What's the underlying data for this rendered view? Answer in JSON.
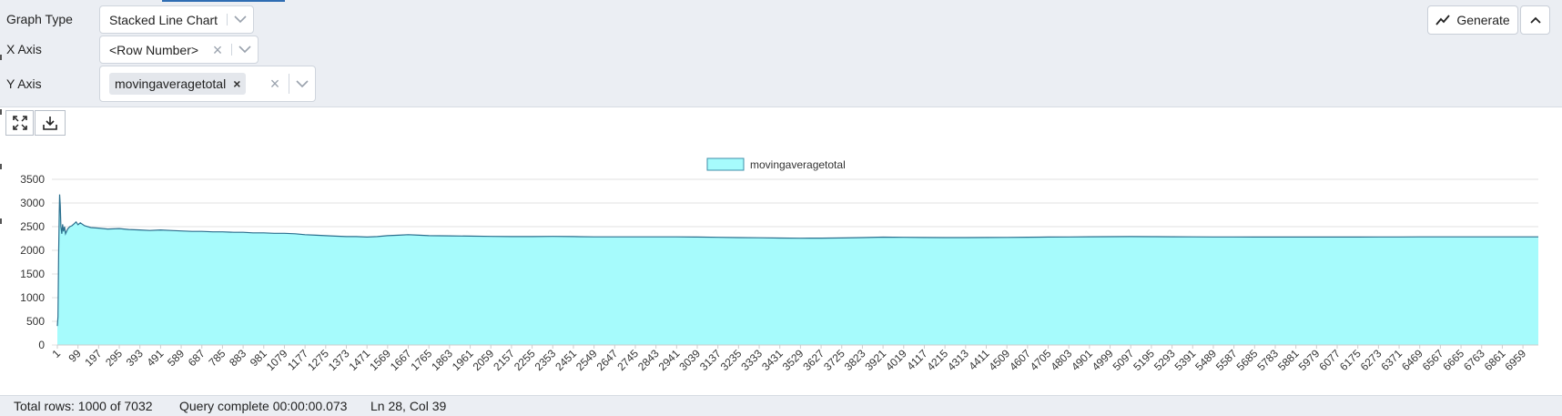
{
  "controls": {
    "graph_type_label": "Graph Type",
    "graph_type_value": "Stacked Line Chart",
    "x_axis_label": "X Axis",
    "x_axis_value": "<Row Number>",
    "y_axis_label": "Y Axis",
    "y_axis_tag": "movingaveragetotal",
    "generate_label": "Generate"
  },
  "status": {
    "total_rows": "Total rows: 1000 of 7032",
    "query_time": "Query complete 00:00:00.073",
    "cursor": "Ln 28, Col 39"
  },
  "colors": {
    "fill": "#a6fbfc",
    "line": "#2b6f8e",
    "legend_border": "#3d8ea8",
    "grid": "#e2e2e2",
    "accent": "#2f6db3"
  },
  "chart_data": {
    "type": "area",
    "stacked": true,
    "legend": {
      "entries": [
        "movingaveragetotal"
      ],
      "position": "top-center"
    },
    "series": [
      {
        "name": "movingaveragetotal",
        "points": [
          [
            1,
            400
          ],
          [
            4,
            600
          ],
          [
            7,
            1900
          ],
          [
            10,
            2800
          ],
          [
            12,
            3180
          ],
          [
            15,
            2950
          ],
          [
            18,
            2500
          ],
          [
            22,
            2350
          ],
          [
            26,
            2550
          ],
          [
            30,
            2400
          ],
          [
            35,
            2500
          ],
          [
            40,
            2350
          ],
          [
            50,
            2450
          ],
          [
            60,
            2500
          ],
          [
            70,
            2520
          ],
          [
            80,
            2560
          ],
          [
            90,
            2600
          ],
          [
            99,
            2540
          ],
          [
            110,
            2580
          ],
          [
            130,
            2520
          ],
          [
            160,
            2480
          ],
          [
            197,
            2470
          ],
          [
            240,
            2450
          ],
          [
            295,
            2460
          ],
          [
            340,
            2440
          ],
          [
            393,
            2430
          ],
          [
            440,
            2420
          ],
          [
            491,
            2430
          ],
          [
            540,
            2420
          ],
          [
            589,
            2410
          ],
          [
            640,
            2400
          ],
          [
            687,
            2400
          ],
          [
            740,
            2390
          ],
          [
            785,
            2390
          ],
          [
            840,
            2380
          ],
          [
            883,
            2380
          ],
          [
            930,
            2370
          ],
          [
            981,
            2370
          ],
          [
            1030,
            2360
          ],
          [
            1079,
            2360
          ],
          [
            1130,
            2350
          ],
          [
            1177,
            2330
          ],
          [
            1230,
            2320
          ],
          [
            1275,
            2310
          ],
          [
            1320,
            2300
          ],
          [
            1373,
            2290
          ],
          [
            1420,
            2290
          ],
          [
            1471,
            2280
          ],
          [
            1520,
            2290
          ],
          [
            1569,
            2310
          ],
          [
            1620,
            2320
          ],
          [
            1667,
            2330
          ],
          [
            1720,
            2320
          ],
          [
            1765,
            2310
          ],
          [
            1863,
            2305
          ],
          [
            1961,
            2300
          ],
          [
            2059,
            2295
          ],
          [
            2157,
            2290
          ],
          [
            2255,
            2290
          ],
          [
            2353,
            2295
          ],
          [
            2451,
            2290
          ],
          [
            2549,
            2285
          ],
          [
            2647,
            2285
          ],
          [
            2745,
            2285
          ],
          [
            2843,
            2285
          ],
          [
            2941,
            2285
          ],
          [
            3039,
            2280
          ],
          [
            3137,
            2275
          ],
          [
            3235,
            2270
          ],
          [
            3333,
            2265
          ],
          [
            3431,
            2260
          ],
          [
            3529,
            2255
          ],
          [
            3627,
            2258
          ],
          [
            3725,
            2262
          ],
          [
            3823,
            2270
          ],
          [
            3921,
            2278
          ],
          [
            4019,
            2275
          ],
          [
            4117,
            2272
          ],
          [
            4215,
            2270
          ],
          [
            4313,
            2270
          ],
          [
            4411,
            2272
          ],
          [
            4509,
            2274
          ],
          [
            4607,
            2276
          ],
          [
            4705,
            2280
          ],
          [
            4803,
            2283
          ],
          [
            4901,
            2286
          ],
          [
            4999,
            2289
          ],
          [
            5097,
            2290
          ],
          [
            5195,
            2288
          ],
          [
            5293,
            2286
          ],
          [
            5391,
            2284
          ],
          [
            5489,
            2283
          ],
          [
            5587,
            2282
          ],
          [
            5685,
            2281
          ],
          [
            5783,
            2280
          ],
          [
            5881,
            2280
          ],
          [
            5979,
            2280
          ],
          [
            6077,
            2280
          ],
          [
            6175,
            2281
          ],
          [
            6273,
            2282
          ],
          [
            6371,
            2283
          ],
          [
            6469,
            2284
          ],
          [
            6567,
            2285
          ],
          [
            6665,
            2285
          ],
          [
            6763,
            2285
          ],
          [
            6861,
            2285
          ],
          [
            6959,
            2285
          ],
          [
            7032,
            2285
          ]
        ]
      }
    ],
    "x_ticks": [
      1,
      99,
      197,
      295,
      393,
      491,
      589,
      687,
      785,
      883,
      981,
      1079,
      1177,
      1275,
      1373,
      1471,
      1569,
      1667,
      1765,
      1863,
      1961,
      2059,
      2157,
      2255,
      2353,
      2451,
      2549,
      2647,
      2745,
      2843,
      2941,
      3039,
      3137,
      3235,
      3333,
      3431,
      3529,
      3627,
      3725,
      3823,
      3921,
      4019,
      4117,
      4215,
      4313,
      4411,
      4509,
      4607,
      4705,
      4803,
      4901,
      4999,
      5097,
      5195,
      5293,
      5391,
      5489,
      5587,
      5685,
      5783,
      5881,
      5979,
      6077,
      6175,
      6273,
      6371,
      6469,
      6567,
      6665,
      6763,
      6861,
      6959
    ],
    "y_ticks": [
      0,
      500,
      1000,
      1500,
      2000,
      2500,
      3000,
      3500
    ],
    "xlim": [
      1,
      7032
    ],
    "ylim": [
      0,
      3500
    ],
    "grid": "horizontal",
    "xlabel": "",
    "ylabel": "",
    "title": ""
  }
}
